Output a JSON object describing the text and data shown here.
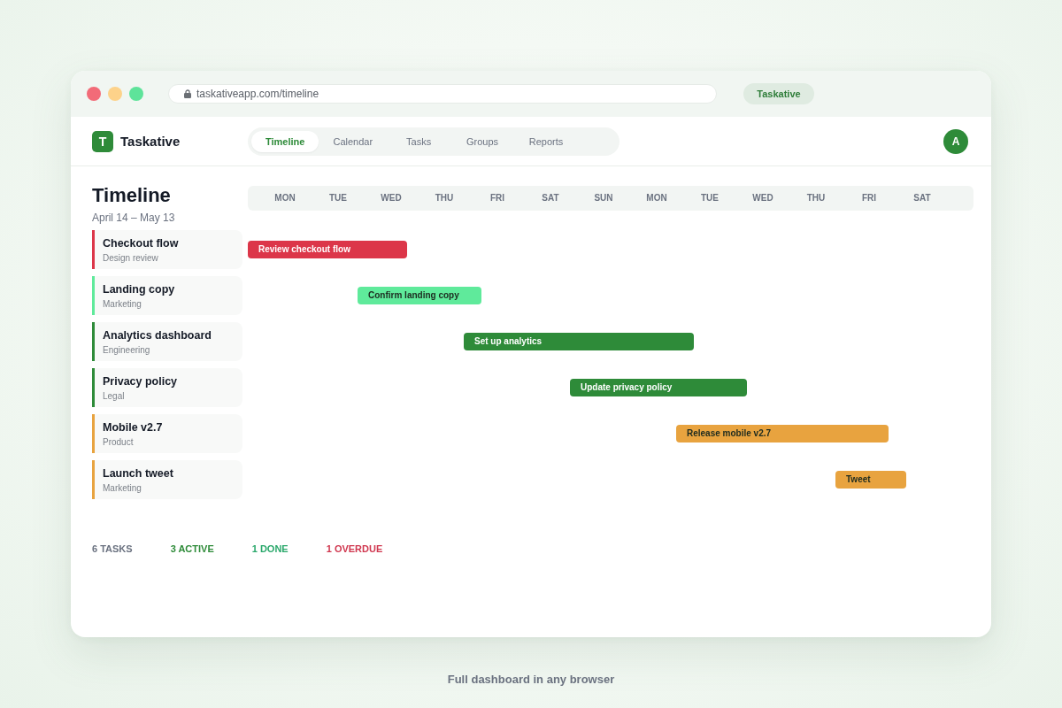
{
  "browser": {
    "url": "taskativeapp.com/timeline",
    "tab": "Taskative"
  },
  "app": {
    "logo_letter": "T",
    "name": "Taskative",
    "nav": [
      {
        "label": "Timeline",
        "selected": true
      },
      {
        "label": "Calendar",
        "selected": false
      },
      {
        "label": "Tasks",
        "selected": false
      },
      {
        "label": "Groups",
        "selected": false
      },
      {
        "label": "Reports",
        "selected": false
      }
    ],
    "avatar": "A"
  },
  "timeline": {
    "title": "Timeline",
    "range": "April 14 – May 13",
    "days": [
      "MON",
      "TUE",
      "WED",
      "THU",
      "FRI",
      "SAT",
      "SUN",
      "MON",
      "TUE",
      "WED",
      "THU",
      "FRI",
      "SAT"
    ],
    "tasks": [
      {
        "title": "Checkout flow",
        "group": "Design review",
        "bar": "Review checkout flow",
        "color": "#dc3649"
      },
      {
        "title": "Landing copy",
        "group": "Marketing",
        "bar": "Confirm landing copy",
        "color": "#5fea9b"
      },
      {
        "title": "Analytics dashboard",
        "group": "Engineering",
        "bar": "Set up analytics",
        "color": "#2e8b39"
      },
      {
        "title": "Privacy policy",
        "group": "Legal",
        "bar": "Update privacy policy",
        "color": "#2e8b39"
      },
      {
        "title": "Mobile v2.7",
        "group": "Product",
        "bar": "Release mobile v2.7",
        "color": "#e8a33f"
      },
      {
        "title": "Launch tweet",
        "group": "Marketing",
        "bar": "Tweet",
        "color": "#e8a33f"
      }
    ]
  },
  "stats": [
    {
      "label": "6 TASKS",
      "color": "#6b7280"
    },
    {
      "label": "3 ACTIVE",
      "color": "#2e8b39"
    },
    {
      "label": "1 DONE",
      "color": "#2aa86b"
    },
    {
      "label": "1 OVERDUE",
      "color": "#d0374f"
    }
  ],
  "caption": "Full dashboard in any browser"
}
